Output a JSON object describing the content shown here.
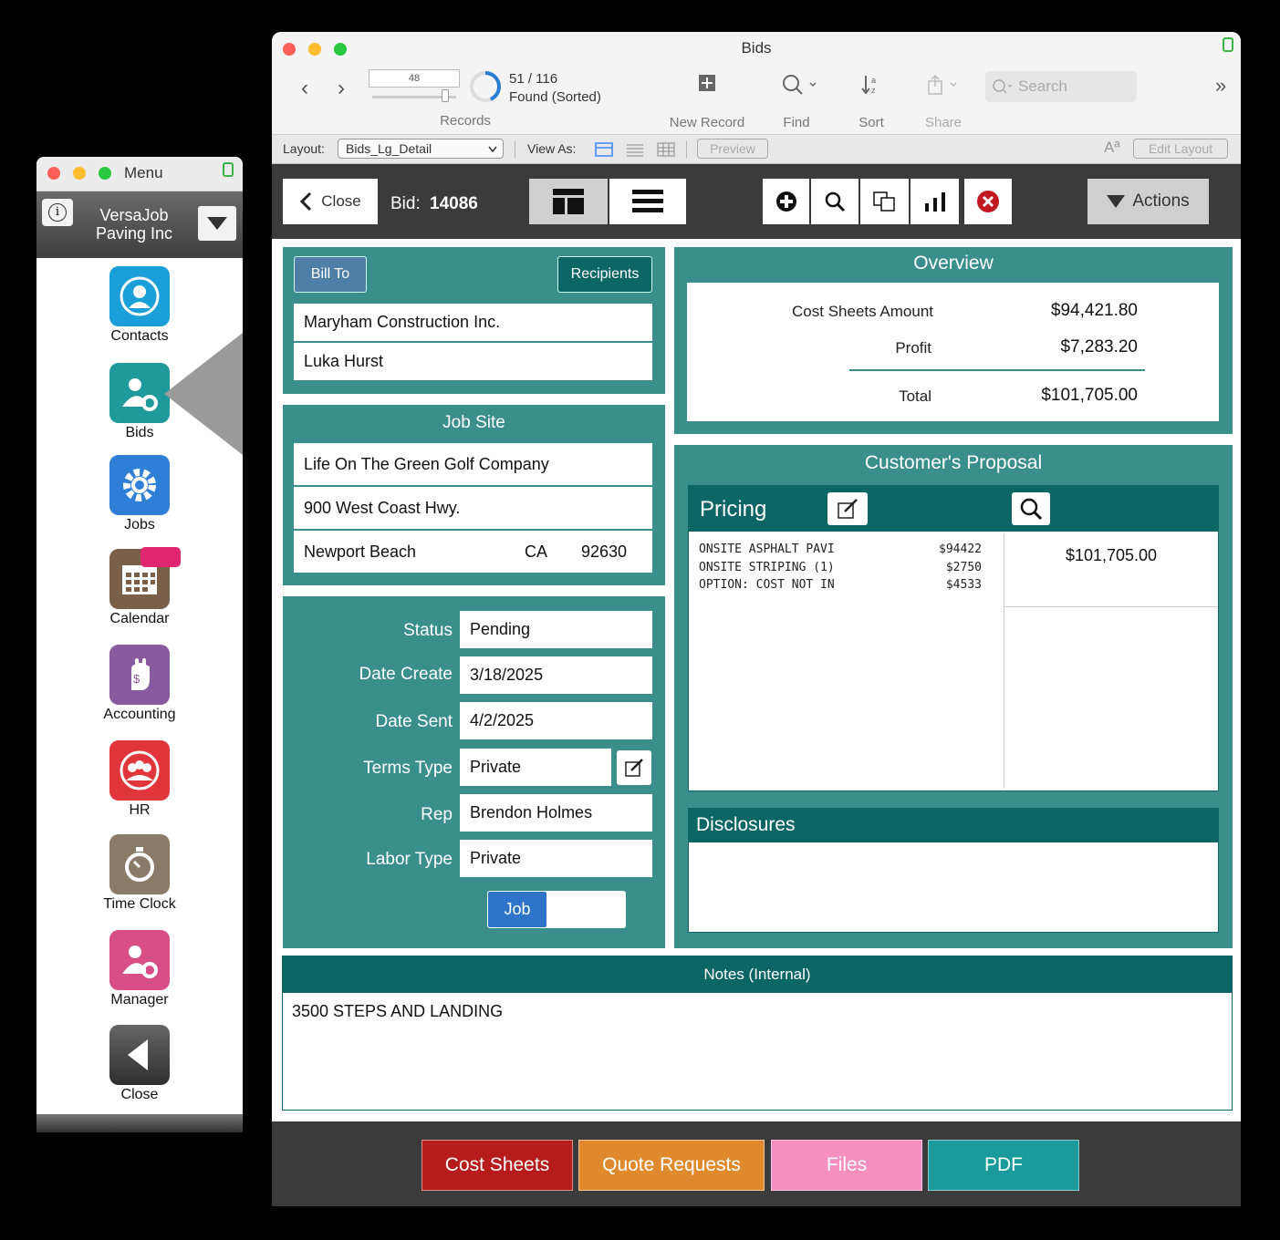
{
  "menu_window": {
    "title": "Menu",
    "company": "VersaJob\nPaving Inc",
    "items": [
      {
        "label": "Contacts",
        "icon": "contacts-icon",
        "color": "#1a9fd8"
      },
      {
        "label": "Bids",
        "icon": "bids-icon",
        "color": "#1e9a9a"
      },
      {
        "label": "Jobs",
        "icon": "jobs-gear-icon",
        "color": "#2f7fd6"
      },
      {
        "label": "Calendar",
        "icon": "calendar-icon",
        "color": "#7a6048"
      },
      {
        "label": "Accounting",
        "icon": "accounting-icon",
        "color": "#8a5a9e"
      },
      {
        "label": "HR",
        "icon": "hr-icon",
        "color": "#e0353a"
      },
      {
        "label": "Time Clock",
        "icon": "time-clock-icon",
        "color": "#8a7a68"
      },
      {
        "label": "Manager",
        "icon": "manager-icon",
        "color": "#d84f86"
      },
      {
        "label": "Close",
        "icon": "close-back-icon",
        "color": "#444444"
      }
    ]
  },
  "main_window": {
    "title": "Bids",
    "toolbar": {
      "record_number": "48",
      "records_count": "51 / 116",
      "records_status": "Found (Sorted)",
      "records_label": "Records",
      "new_record_label": "New Record",
      "find_label": "Find",
      "sort_label": "Sort",
      "share_label": "Share",
      "search_placeholder": "Search"
    },
    "layout_bar": {
      "layout_label": "Layout:",
      "layout_value": "Bids_Lg_Detail",
      "view_as_label": "View As:",
      "preview_label": "Preview",
      "edit_layout_label": "Edit Layout",
      "font_icon": "Aª"
    },
    "header": {
      "close_label": "Close",
      "bid_label": "Bid:",
      "bid_number": "14086",
      "actions_label": "Actions"
    },
    "bill_to": {
      "bill_to_button": "Bill To",
      "recipients_button": "Recipients",
      "company": "Maryham Construction Inc.",
      "contact": "Luka Hurst"
    },
    "job_site": {
      "title": "Job Site",
      "name": "Life On The Green Golf Company",
      "address": "900 West Coast Hwy.",
      "city": "Newport Beach",
      "state": "CA",
      "zip": "92630"
    },
    "details": {
      "status_label": "Status",
      "status": "Pending",
      "date_create_label": "Date Create",
      "date_create": "3/18/2025",
      "date_sent_label": "Date Sent",
      "date_sent": "4/2/2025",
      "terms_type_label": "Terms Type",
      "terms_type": "Private",
      "rep_label": "Rep",
      "rep": "Brendon Holmes",
      "labor_type_label": "Labor Type",
      "labor_type": "Private",
      "job_button": "Job"
    },
    "overview": {
      "title": "Overview",
      "cost_sheets_label": "Cost Sheets Amount",
      "cost_sheets_amount": "$94,421.80",
      "profit_label": "Profit",
      "profit": "$7,283.20",
      "total_label": "Total",
      "total": "$101,705.00"
    },
    "proposal": {
      "title": "Customer's Proposal",
      "pricing_title": "Pricing",
      "lines": [
        {
          "desc": "ONSITE ASPHALT PAVI",
          "amount": "$94422"
        },
        {
          "desc": "ONSITE STRIPING (1)",
          "amount": "$2750"
        },
        {
          "desc": "OPTION: COST NOT IN",
          "amount": "$4533"
        }
      ],
      "total": "$101,705.00",
      "disclosures_title": "Disclosures"
    },
    "notes": {
      "title": "Notes (Internal)",
      "text": "3500 STEPS AND LANDING"
    },
    "footer": {
      "cost_sheets": "Cost Sheets",
      "quote_requests": "Quote Requests",
      "files": "Files",
      "pdf": "PDF"
    }
  },
  "colors": {
    "teal_panel": "#3a8e8c",
    "dark_teal": "#0c6666",
    "cost_sheets": "#b71c1c",
    "quote_requests": "#e08a2e",
    "files": "#f48fc0",
    "pdf": "#1a9a9a",
    "job_button": "#2e74c8"
  }
}
